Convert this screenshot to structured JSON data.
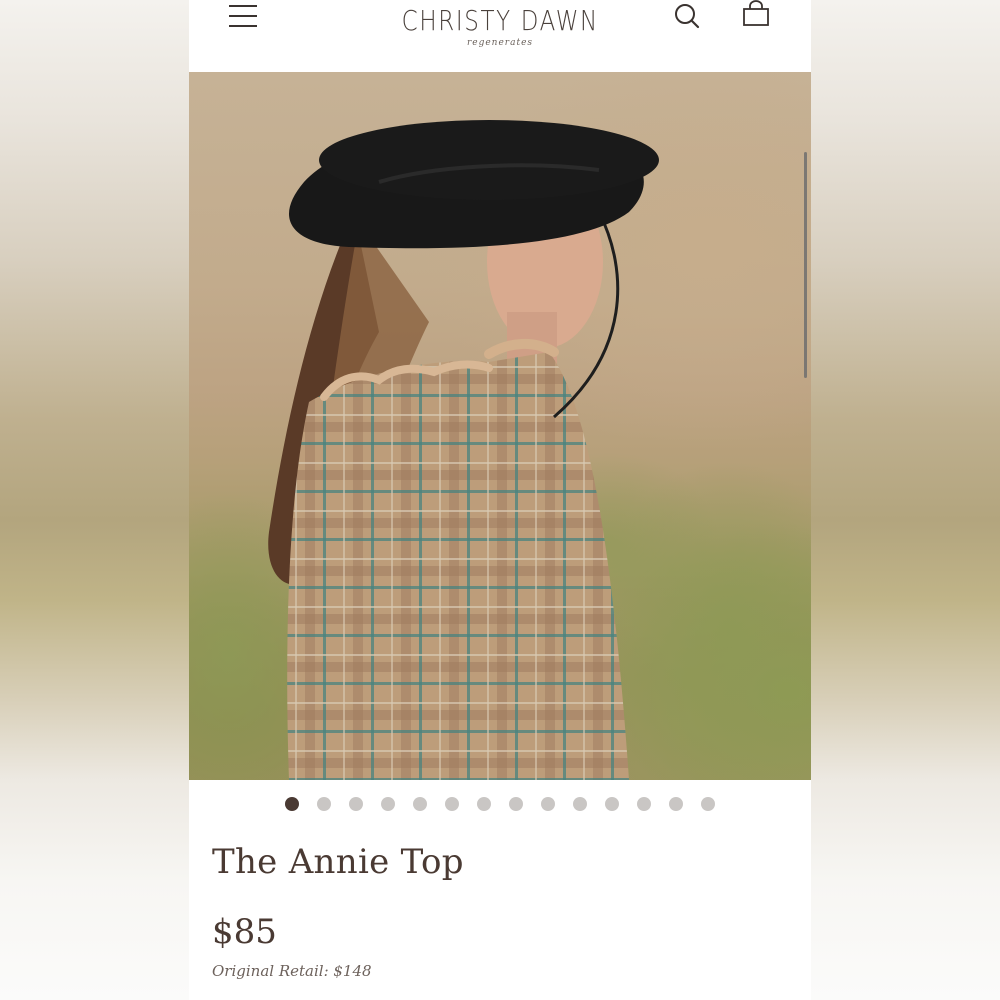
{
  "header": {
    "brand": "CHRISTY DAWN",
    "tagline": "regenerates",
    "menu_icon": "hamburger-menu-icon",
    "search_icon": "search-icon",
    "bag_icon": "shopping-bag-icon"
  },
  "gallery": {
    "image_count": 14,
    "active_index": 0
  },
  "product": {
    "title": "The Annie Top",
    "price": "$85",
    "original_retail": "Original Retail: $148"
  },
  "colors": {
    "text_primary": "#4a3a33",
    "dot_active": "#4a3a33",
    "dot_inactive": "#c9c6c4"
  }
}
